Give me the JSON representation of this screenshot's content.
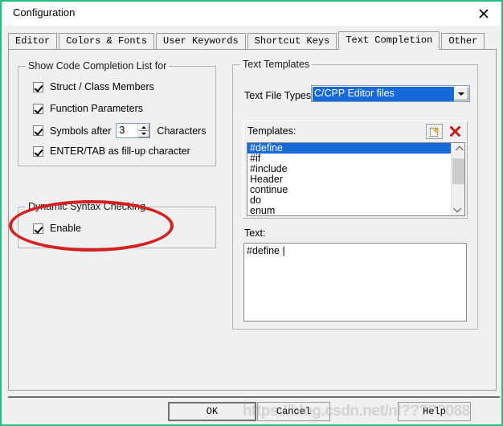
{
  "window": {
    "title": "Configuration",
    "close_icon": "close-icon",
    "border_color": "#21c183"
  },
  "tabs": [
    {
      "label": "Editor",
      "active": false
    },
    {
      "label": "Colors & Fonts",
      "active": false
    },
    {
      "label": "User Keywords",
      "active": false
    },
    {
      "label": "Shortcut Keys",
      "active": false
    },
    {
      "label": "Text Completion",
      "active": true
    },
    {
      "label": "Other",
      "active": false
    }
  ],
  "code_completion_group": {
    "title": "Show Code Completion List for",
    "items": [
      {
        "label": "Struct / Class Members",
        "checked": true
      },
      {
        "label": "Function Parameters",
        "checked": true
      },
      {
        "label": "Symbols after",
        "checked": true,
        "suffix": "Characters",
        "value": "3"
      },
      {
        "label": "ENTER/TAB as fill-up character",
        "checked": true
      }
    ]
  },
  "syntax_group": {
    "title": "Dynamic Syntax Checking",
    "enable": {
      "label": "Enable",
      "checked": true
    }
  },
  "templates_group": {
    "title": "Text Templates",
    "file_types_label": "Text File Types:",
    "file_types_value": "C/CPP Editor files",
    "file_types_arrow_icon": "chevron-down-icon",
    "templates_label": "Templates:",
    "new_icon": "new-template-icon",
    "delete_icon": "delete-template-icon",
    "items": [
      {
        "label": "#define",
        "selected": true
      },
      {
        "label": "#if",
        "selected": false
      },
      {
        "label": "#include",
        "selected": false
      },
      {
        "label": "Header",
        "selected": false
      },
      {
        "label": "continue",
        "selected": false
      },
      {
        "label": "do",
        "selected": false
      },
      {
        "label": "enum",
        "selected": false
      }
    ],
    "scroll_up_icon": "chevron-up-icon",
    "scroll_down_icon": "chevron-down-icon",
    "text_label": "Text:",
    "text_value": "#define |"
  },
  "buttons": {
    "ok": "OK",
    "cancel": "Cancel",
    "help": "Help"
  },
  "annotation": {
    "shape": "ellipse",
    "color": "#d42020"
  },
  "watermark": {
    "text": "https://blog.csdn.net/nl?????088"
  }
}
